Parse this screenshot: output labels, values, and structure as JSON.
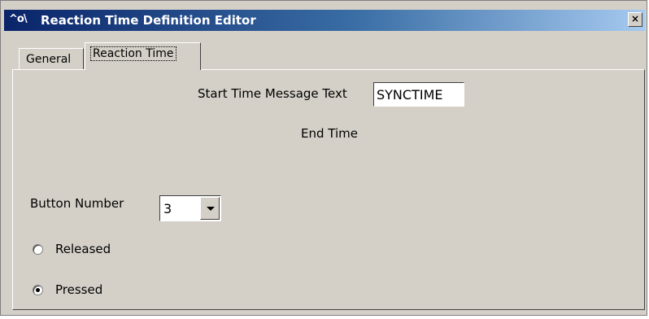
{
  "window": {
    "icon_glyph": "^o\\",
    "title": "Reaction Time Definition Editor",
    "close_glyph": "×"
  },
  "tabs": [
    {
      "label": "General",
      "active": false
    },
    {
      "label": "Reaction Time",
      "active": true
    }
  ],
  "form": {
    "start_time_label": "Start Time Message Text",
    "start_time_value": "SYNCTIME",
    "end_time_label": "End Time",
    "button_number_label": "Button Number",
    "button_number_value": "3",
    "radios": [
      {
        "label": "Released",
        "checked": false
      },
      {
        "label": "Pressed",
        "checked": true
      }
    ]
  }
}
